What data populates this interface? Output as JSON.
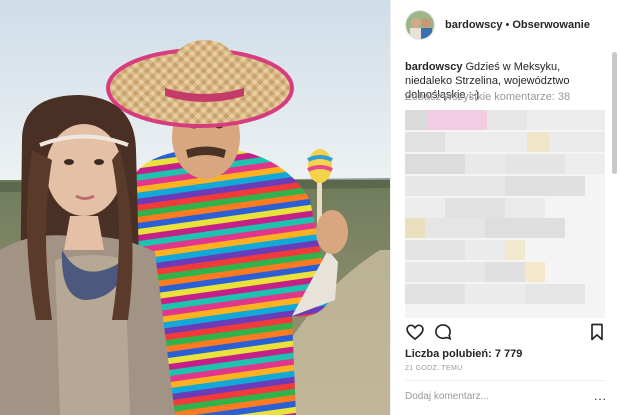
{
  "post_header": {
    "username": "bardowscy",
    "separator": "•",
    "follow_label": "Obserwowanie"
  },
  "caption": {
    "username": "bardowscy",
    "text": "Gdzieś w Meksyku, niedaleko Strzelina, województwo dolnośląskie :-)"
  },
  "comments": {
    "view_all_label": "Zobacz wszystkie komentarze: 38",
    "blurred": true
  },
  "actions": {
    "icons": [
      "heart-icon",
      "comment-icon",
      "bookmark-icon"
    ]
  },
  "likes_label": "Liczba polubień: 7 779",
  "timestamp": "21 GODZ. TEMU",
  "comment_box": {
    "placeholder": "Dodaj komentarz...",
    "more_label": "..."
  },
  "colors": {
    "text": "#262626",
    "muted": "#999999",
    "divider": "#efefef"
  }
}
